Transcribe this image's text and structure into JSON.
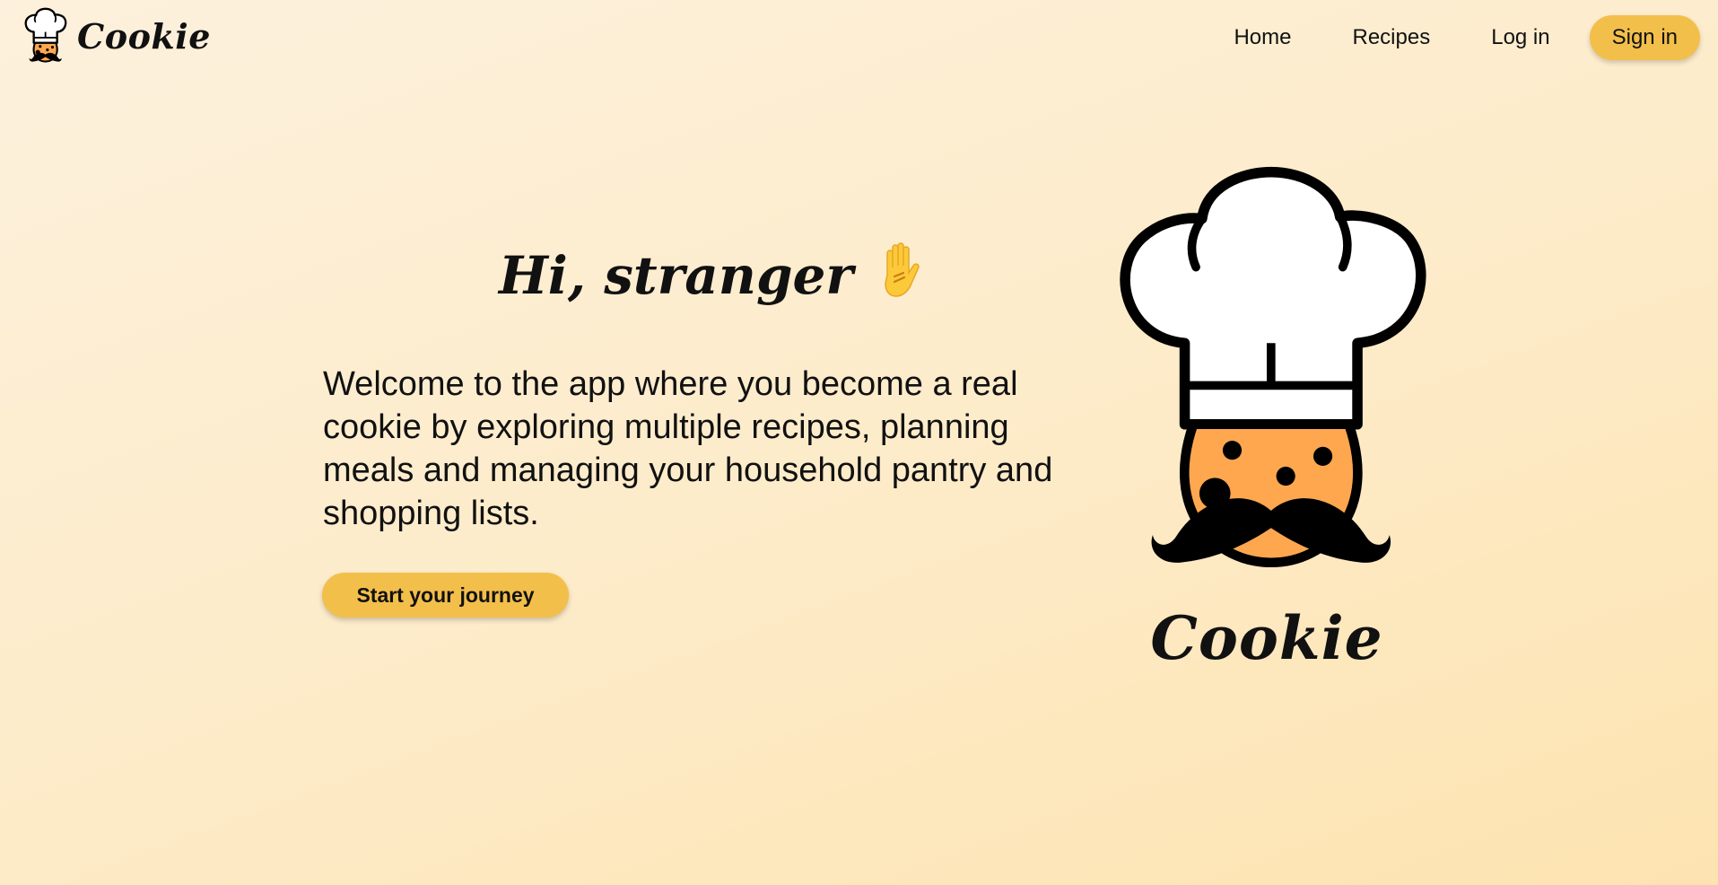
{
  "brand": {
    "name": "Cookie",
    "icon": "chef-cookie-icon"
  },
  "nav": {
    "items": [
      {
        "label": "Home"
      },
      {
        "label": "Recipes"
      },
      {
        "label": "Log in"
      }
    ],
    "signin_label": "Sign in"
  },
  "hero": {
    "greeting": "Hi, stranger",
    "greeting_icon": "raised-hand-icon",
    "description": "Welcome to the app where you become a real cookie by exploring multiple recipes, planning meals and managing your household pantry and shopping lists.",
    "cta_label": "Start your journey",
    "logo_title": "Cookie",
    "logo_icon": "chef-cookie-icon"
  },
  "colors": {
    "accent": "#f3bf4b",
    "cookie": "#ffa74f",
    "background_start": "#fdf1dd",
    "background_end": "#fde3b0"
  }
}
